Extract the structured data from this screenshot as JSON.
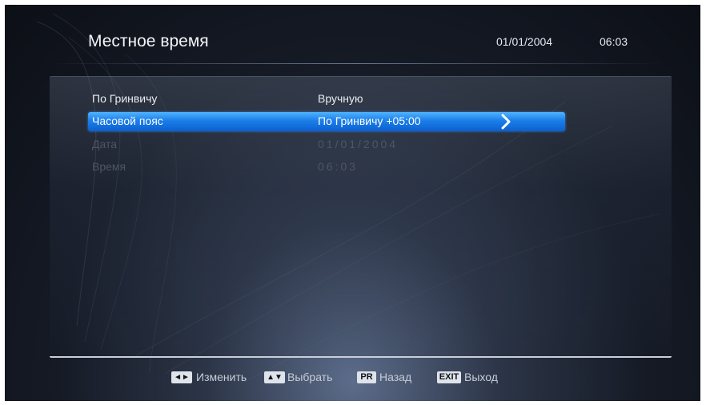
{
  "header": {
    "title": "Местное время",
    "date": "01/01/2004",
    "time": "06:03"
  },
  "menu": {
    "rows": [
      {
        "label": "По Гринвичу",
        "value": "Вручную",
        "state": "normal"
      },
      {
        "label": "Часовой пояс",
        "value": "По Гринвичу +05:00",
        "state": "selected"
      },
      {
        "label": "Дата",
        "value": "01/01/2004",
        "state": "disabled"
      },
      {
        "label": "Время",
        "value": "06:03",
        "state": "disabled"
      }
    ]
  },
  "footer": {
    "hints": [
      {
        "key": "◄►",
        "label": "Изменить",
        "icon": "left-right-arrows-icon"
      },
      {
        "key": "▲▼",
        "label": "Выбрать",
        "icon": "up-down-arrows-icon"
      },
      {
        "key": "PR",
        "label": "Назад",
        "icon": "pr-key-icon"
      },
      {
        "key": "EXIT",
        "label": "Выход",
        "icon": "exit-key-icon"
      }
    ]
  },
  "colors": {
    "selection": "#1b7ee9",
    "background": "#151a25",
    "text": "#e8ebf1",
    "disabled_text": "#4e5566"
  }
}
